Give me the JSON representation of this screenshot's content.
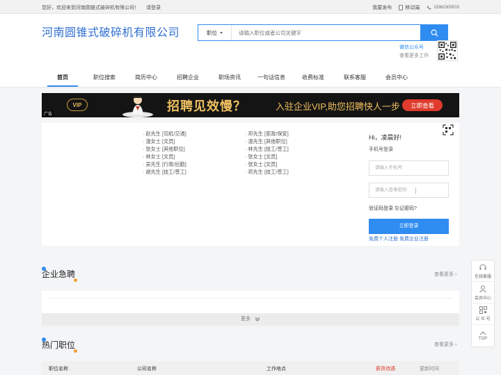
{
  "topbar": {
    "welcome": "您好，欢迎来到河南圆锥式破碎机有限公司！",
    "login": "请登录",
    "post": "我要发布",
    "mobile": "移动端",
    "phone": "15362300515"
  },
  "header": {
    "site_name": "河南圆锥式破碎机有限公司",
    "search": {
      "category": "职位",
      "placeholder": "请输入职位或者公司关键字"
    },
    "wechat_label": "微信公众号",
    "more_jobs": "查看更多工作"
  },
  "nav": [
    {
      "label": "首页",
      "active": true
    },
    {
      "label": "职位搜索"
    },
    {
      "label": "简历中心"
    },
    {
      "label": "招聘企业"
    },
    {
      "label": "职场资讯"
    },
    {
      "label": "一句话信息"
    },
    {
      "label": "收费标准"
    },
    {
      "label": "联系客服"
    },
    {
      "label": "会员中心"
    }
  ],
  "banner": {
    "ad_tag": "广告",
    "vip": "VIP",
    "slogan": "招聘见效慢？",
    "sub": "入驻企业VIP,助您招聘快人一步",
    "cta": "立即查看"
  },
  "names": {
    "col1": [
      "· 赵先生 [司机/交通]",
      "· 温女士 [文员]",
      "· 张女士 [其他职位]",
      "· 林女士 [文员]",
      "· 吴先生 [行政/后勤]",
      "· 胡先生 [技工/普工]"
    ],
    "col2": [
      "· 邓先生 [家政/保安]",
      "· 温先生 [其他职位]",
      "· 林先生 [技工/普工]",
      "· 张女士 [文员]",
      "· 张女士 [文员]",
      "· 邓先生 [技工/普工]"
    ]
  },
  "loginbox": {
    "greeting": "Hi，凌晨好!",
    "tab": "手机号登录",
    "phone_placeholder": "请输入手机号",
    "password_placeholder": "请输入登录密码",
    "links": "验证码登录  忘记密码?",
    "submit": "立即登录",
    "register": "免费个人注册  免费企业注册"
  },
  "sections": {
    "urgent_title": "企业急聘",
    "urgent_more": "查看更多 ›",
    "more_bar": "更多",
    "hot_title": "热门职位",
    "hot_more": "查看更多 ›"
  },
  "table_head": {
    "job": "职位名称",
    "company": "公司名称",
    "location": "工作地点",
    "salary": "薪资待遇",
    "updated": "更新时间"
  },
  "floatbar": {
    "online": "在线客服",
    "member": "会员中心",
    "public": "公 众 号",
    "top": "TOP"
  },
  "colors": {
    "accent": "#2f8cf0",
    "salary": "#e03b2c"
  }
}
